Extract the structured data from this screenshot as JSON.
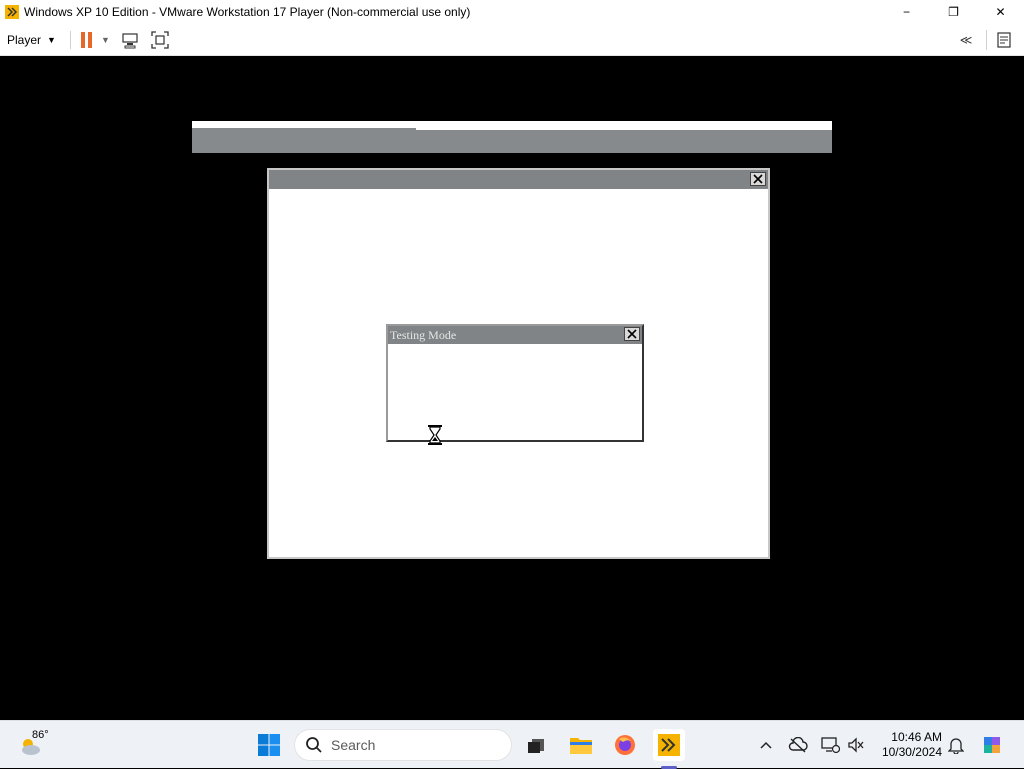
{
  "window": {
    "title": "Windows XP 10 Edition - VMware Workstation 17 Player (Non-commercial use only)",
    "minimize": "−",
    "maximize": "❐",
    "close": "✕"
  },
  "toolbar": {
    "player_label": "Player",
    "player_caret": "▼",
    "pause_caret": "▼",
    "back_label": "≪"
  },
  "vm": {
    "dialog_title": "Testing Mode"
  },
  "taskbar": {
    "weather_temp": "86°",
    "search_placeholder": "Search",
    "time": "10:46 AM",
    "date": "10/30/2024"
  },
  "colors": {
    "pause_accent": "#e8672a",
    "vm_titlebar": "#808486",
    "taskbar_bg": "#eef1f6"
  }
}
